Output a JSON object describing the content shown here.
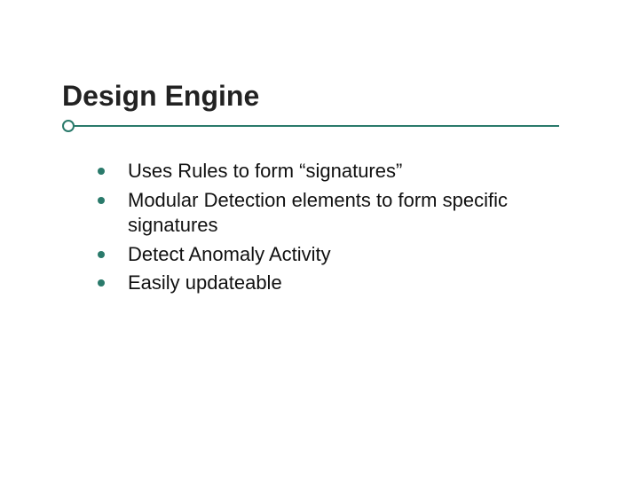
{
  "slide": {
    "title": "Design Engine",
    "bullets": [
      "Uses Rules to form “signatures”",
      "Modular Detection elements to form specific signatures",
      "Detect Anomaly Activity",
      "Easily updateable"
    ]
  },
  "colors": {
    "accent": "#2a7a6b"
  }
}
